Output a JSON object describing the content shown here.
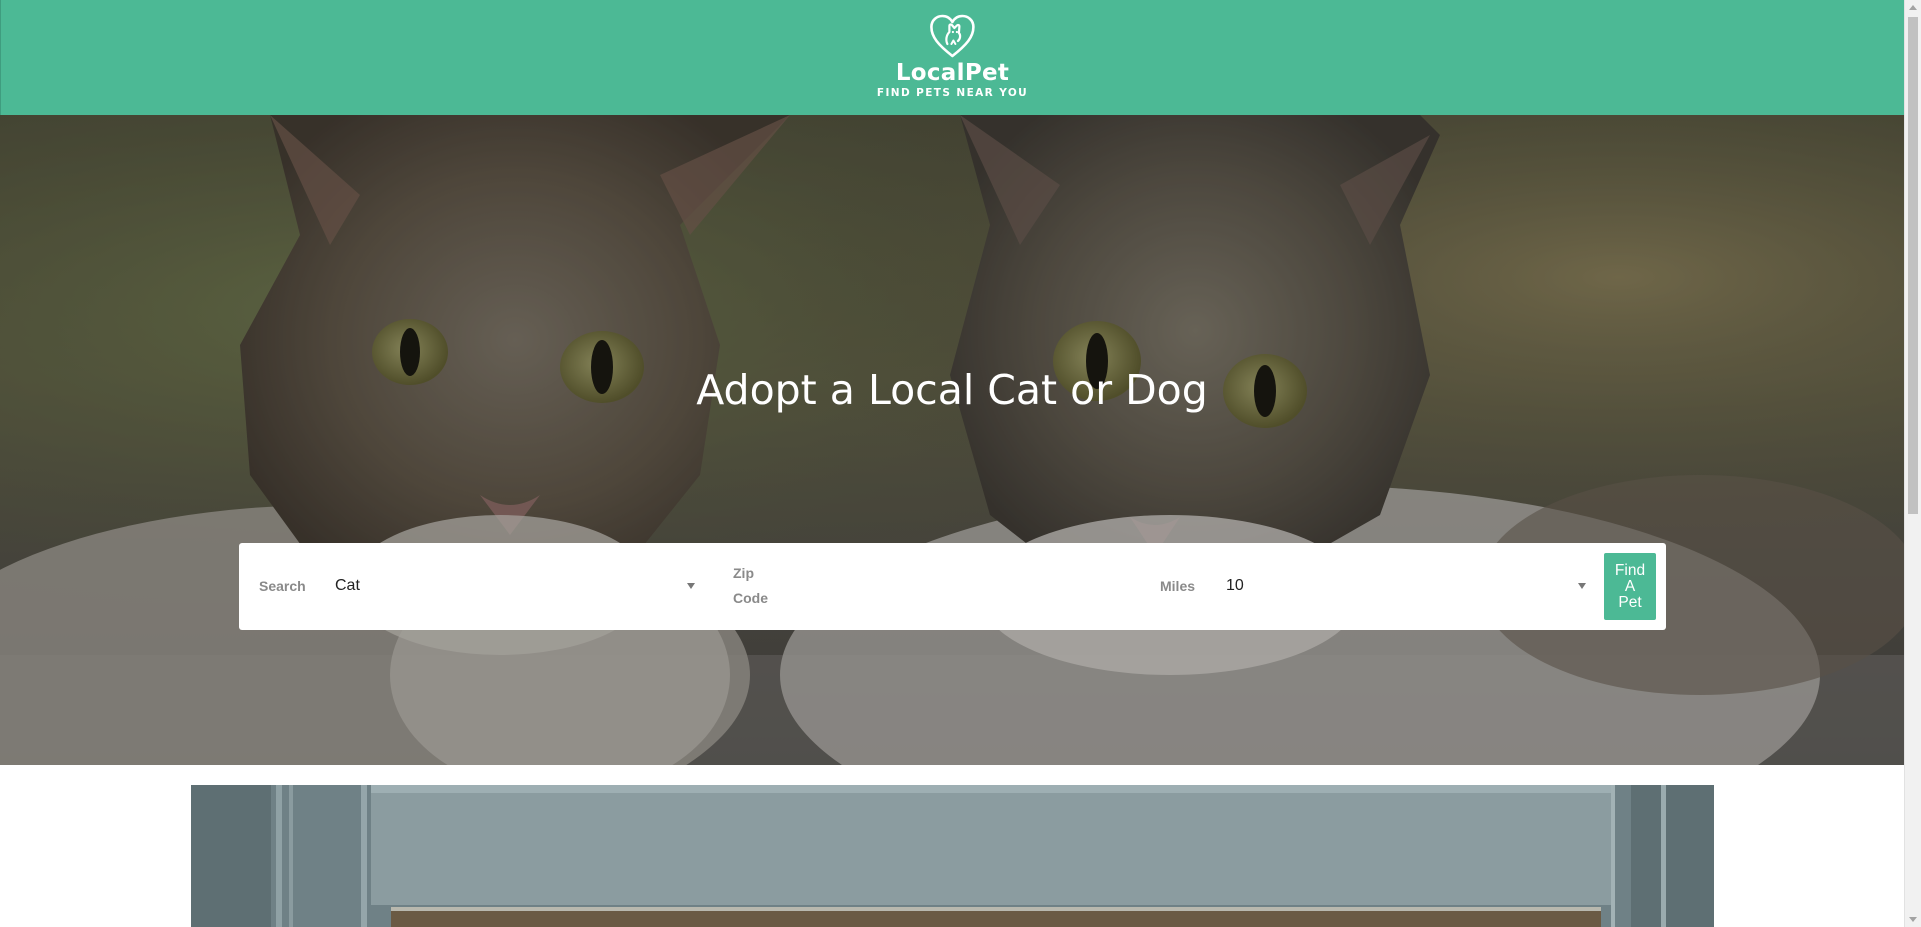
{
  "header": {
    "logo_name": "LocalPet",
    "logo_tagline": "FIND PETS NEAR YOU",
    "background_color": "#4cb995",
    "logo_icon": "heart-with-pet-icon"
  },
  "hero": {
    "title": "Adopt a Local Cat or Dog",
    "image": "two-tabby-cats-photo"
  },
  "search": {
    "search_label": "Search",
    "pet_type_value": "Cat",
    "zip_label": "Zip Code",
    "zip_value": "",
    "miles_label": "Miles",
    "miles_value": "10",
    "submit_label": "Find A Pet",
    "button_color": "#4cb995"
  },
  "content": {
    "feature_image": "pet-feature-photo"
  }
}
